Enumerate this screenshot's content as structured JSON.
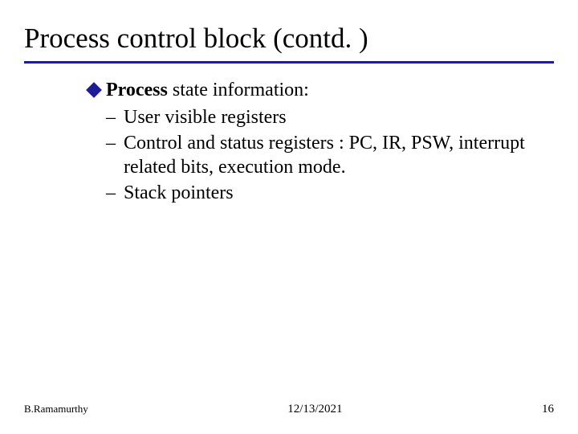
{
  "slide": {
    "title": "Process control block (contd. )",
    "lead_bold": "Process",
    "lead_rest": " state information:",
    "items": [
      "User visible registers",
      "Control and status registers : PC, IR, PSW, interrupt related bits, execution mode.",
      "Stack pointers"
    ]
  },
  "footer": {
    "author": "B.Ramamurthy",
    "date": "12/13/2021",
    "page": "16"
  }
}
